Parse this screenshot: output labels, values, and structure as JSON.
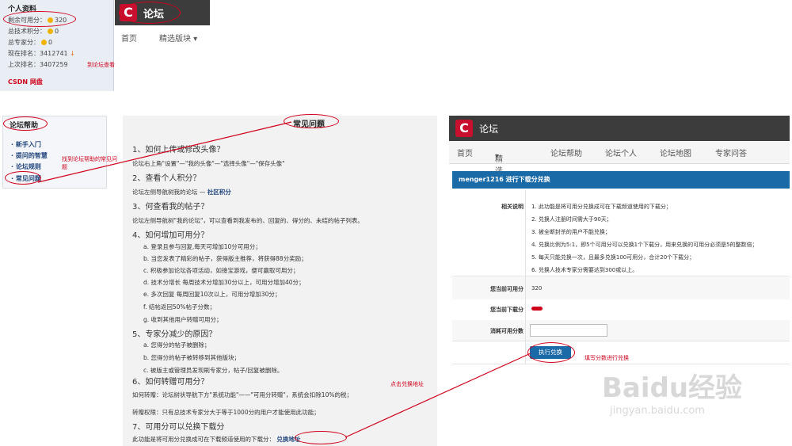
{
  "profile": {
    "title": "个人资料",
    "rows": [
      {
        "label": "剩余可用分：",
        "value": "320"
      },
      {
        "label": "总技术积分：",
        "value": "0"
      },
      {
        "label": "总专家分：",
        "value": "0"
      },
      {
        "label": "现在排名：",
        "value": "3412741"
      },
      {
        "label": "上次排名：",
        "value": "3407259"
      }
    ],
    "link": "CSDN 网盘"
  },
  "forum_header": {
    "logo": "C",
    "title": "论坛",
    "tabs": [
      "首页",
      "精选版块"
    ]
  },
  "annotations": {
    "check_points": "到论坛查看积分",
    "find_help": "找到论坛帮助的常见问题",
    "click_exchange": "点击兑换地址",
    "fill_score": "填写分数进行兑换"
  },
  "help_menu": {
    "title": "论坛帮助",
    "items": [
      "新手入门",
      "提问的智慧",
      "论坛规则",
      "常见问题"
    ]
  },
  "faq": {
    "title": "常见问题",
    "q1": "1、如何上传或修改头像？",
    "q1_a": "论坛右上角\"设置\"—\"我的头像\"—\"选择头像\"—\"保存头像\"",
    "q2": "2、查看个人积分？",
    "q2_a": "论坛左侧导航树我的论坛 —",
    "q2_link": "社区积分",
    "q3": "3、何查看我的帖子？",
    "q3_a": "论坛左侧导航树\"我的论坛\"，可以查看到我发布的、回复的、得分的、未结的帖子列表。",
    "q4": "4、如何增加可用分？",
    "q4_items": [
      "a. 登录且参与回复,每天可增加10分可用分；",
      "b. 当您发表了精彩的帖子，获得版主推荐，将获得88分奖励；",
      "c. 积极参加论坛各项活动，如接宝游戏，便可赢取可用分；",
      "d. 技术分增长 每周技术分增加30分以上，可用分增加40分；",
      "e. 多次回复 每周回复10次以上，可用分增加30分；",
      "f. 结帖返回50%帖子分数；",
      "g. 收到其他用户转赠可用分；"
    ],
    "q5": "5、专家分减少的原因？",
    "q5_items": [
      "a. 您得分的帖子被删除；",
      "b. 您得分的帖子被转移到其他版块；",
      "c. 被版主或管理员发现刷专家分，帖子/回复被删除。"
    ],
    "q6": "6、如何转赠可用分？",
    "q6_a1": "如何转赠：论坛树状导航下方\"系统功能\"——\"可用分转赠\"，系统会扣除10%的税；",
    "q6_a2": "转赠权限：只有总技术专家分大于等于1000分的用户才能使用此功能；",
    "q7": "7、可用分可以兑换下载分",
    "q7_a": "此功能是将可用分兑换成可在下载频道使用的下载分：",
    "q7_link": "兑换地址"
  },
  "exchange": {
    "logo": "C",
    "title": "论坛",
    "nav": [
      "首页",
      "精选版块",
      "论坛帮助",
      "论坛个人",
      "论坛地图",
      "专家问答"
    ],
    "bar_title": "menger1216 进行下载分兑换",
    "rules_label": "相关说明",
    "rules": [
      "1. 此功能是将可用分兑换成可在下载频道使用的下载分；",
      "2. 兑换人注册时间需大于90天；",
      "3. 被全断封杀的用户不能兑换；",
      "4. 兑换比例为5:1，即5个可用分可以兑换1个下载分，用来兑换的可用分必须是5的整数倍；",
      "5. 每天只能兑换一次，且最多兑换100可用分，合计20个下载分；",
      "6. 兑换人技术专家分需要达到300或以上。"
    ],
    "current_points_label": "您当前可用分",
    "current_points": "320",
    "current_download_label": "您当前下载分",
    "consume_label": "消耗可用分数",
    "consume_value": "",
    "submit": "执行兑换"
  },
  "watermark": {
    "brand": "Baidu经验",
    "url": "jingyan.baidu.com"
  }
}
